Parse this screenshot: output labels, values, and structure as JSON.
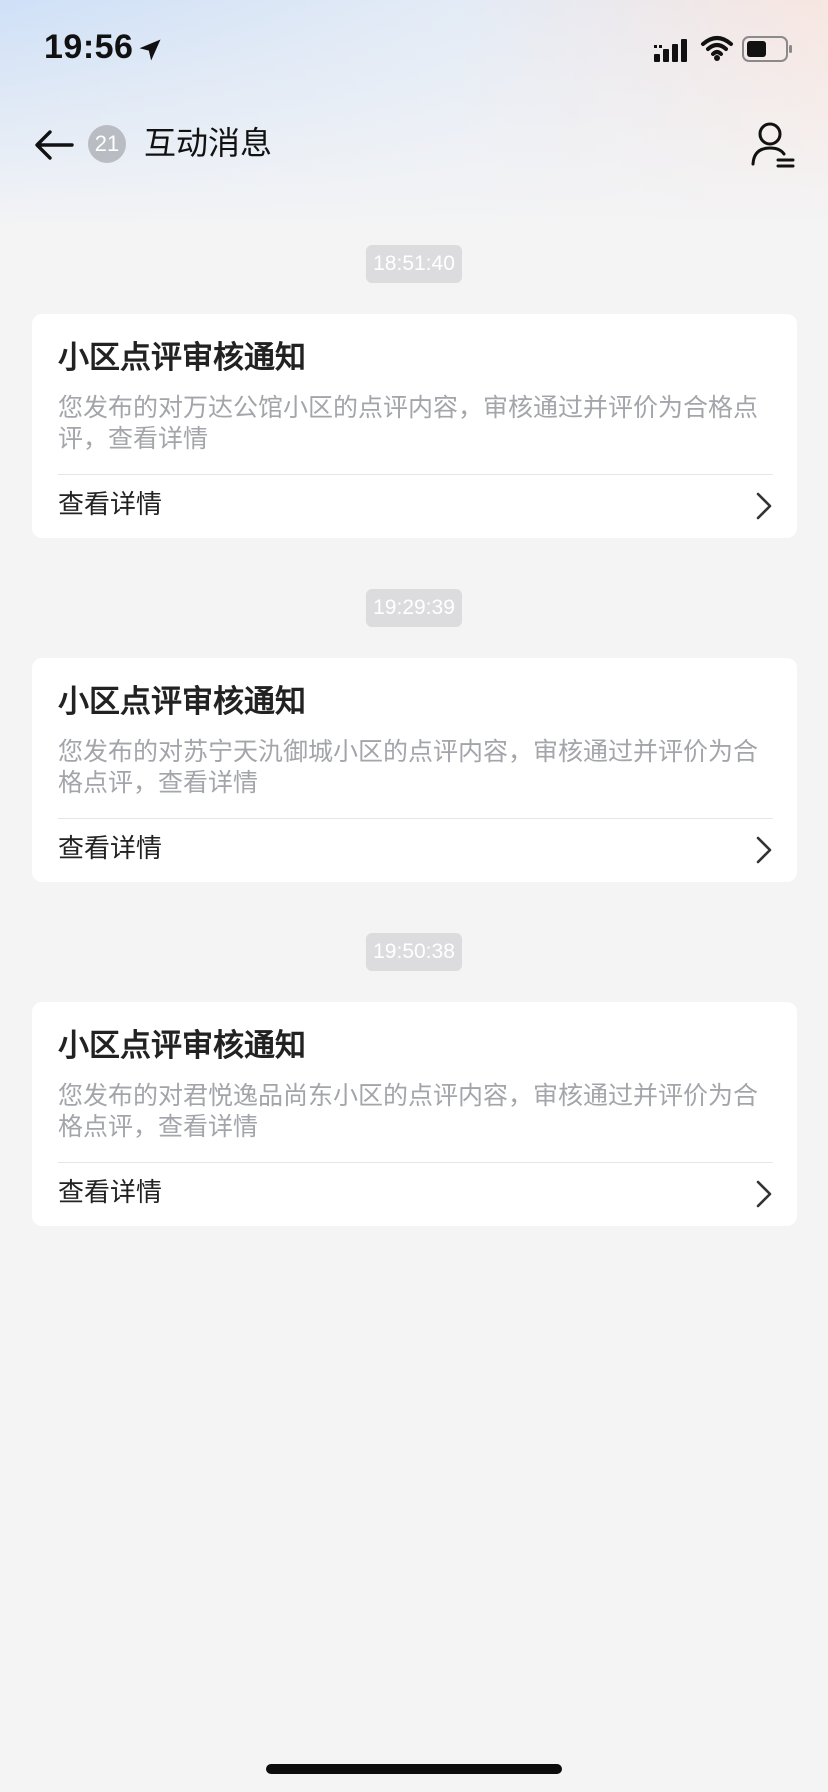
{
  "status_bar": {
    "time": "19:56"
  },
  "header": {
    "badge_count": "21",
    "title": "互动消息"
  },
  "messages": [
    {
      "time": "18:51:40",
      "title": "小区点评审核通知",
      "body": "您发布的对万达公馆小区的点评内容，审核通过并评价为合格点评，查看详情",
      "link_label": "查看详情"
    },
    {
      "time": "19:29:39",
      "title": "小区点评审核通知",
      "body": "您发布的对苏宁天氿御城小区的点评内容，审核通过并评价为合格点评，查看详情",
      "link_label": "查看详情"
    },
    {
      "time": "19:50:38",
      "title": "小区点评审核通知",
      "body": "您发布的对君悦逸品尚东小区的点评内容，审核通过并评价为合格点评，查看详情",
      "link_label": "查看详情"
    }
  ],
  "colors": {
    "background": "#f4f4f5",
    "card": "#ffffff",
    "body_text": "#a3a5aa",
    "timestamp_bg": "#dcdcdf",
    "badge_bg": "#b9bcc2"
  }
}
